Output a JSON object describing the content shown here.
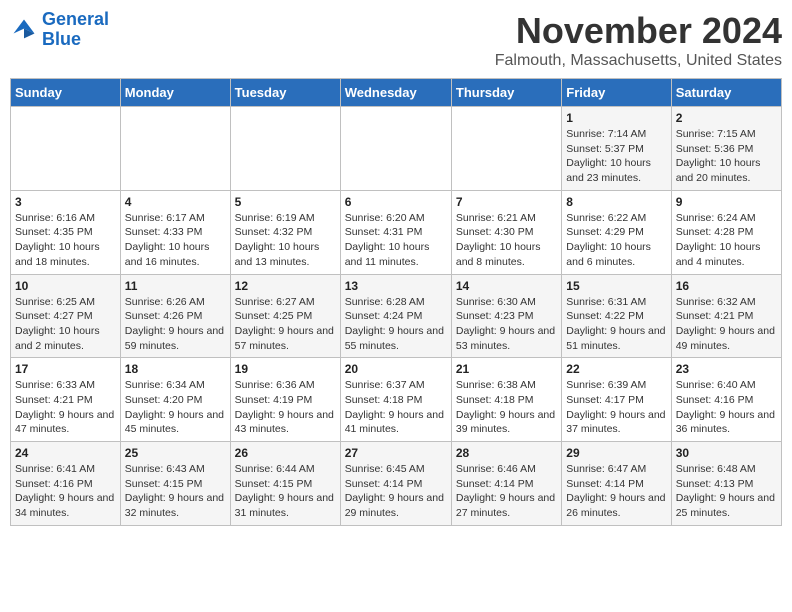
{
  "header": {
    "logo_line1": "General",
    "logo_line2": "Blue",
    "month": "November 2024",
    "location": "Falmouth, Massachusetts, United States"
  },
  "weekdays": [
    "Sunday",
    "Monday",
    "Tuesday",
    "Wednesday",
    "Thursday",
    "Friday",
    "Saturday"
  ],
  "weeks": [
    [
      {
        "day": "",
        "info": ""
      },
      {
        "day": "",
        "info": ""
      },
      {
        "day": "",
        "info": ""
      },
      {
        "day": "",
        "info": ""
      },
      {
        "day": "",
        "info": ""
      },
      {
        "day": "1",
        "info": "Sunrise: 7:14 AM\nSunset: 5:37 PM\nDaylight: 10 hours and 23 minutes."
      },
      {
        "day": "2",
        "info": "Sunrise: 7:15 AM\nSunset: 5:36 PM\nDaylight: 10 hours and 20 minutes."
      }
    ],
    [
      {
        "day": "3",
        "info": "Sunrise: 6:16 AM\nSunset: 4:35 PM\nDaylight: 10 hours and 18 minutes."
      },
      {
        "day": "4",
        "info": "Sunrise: 6:17 AM\nSunset: 4:33 PM\nDaylight: 10 hours and 16 minutes."
      },
      {
        "day": "5",
        "info": "Sunrise: 6:19 AM\nSunset: 4:32 PM\nDaylight: 10 hours and 13 minutes."
      },
      {
        "day": "6",
        "info": "Sunrise: 6:20 AM\nSunset: 4:31 PM\nDaylight: 10 hours and 11 minutes."
      },
      {
        "day": "7",
        "info": "Sunrise: 6:21 AM\nSunset: 4:30 PM\nDaylight: 10 hours and 8 minutes."
      },
      {
        "day": "8",
        "info": "Sunrise: 6:22 AM\nSunset: 4:29 PM\nDaylight: 10 hours and 6 minutes."
      },
      {
        "day": "9",
        "info": "Sunrise: 6:24 AM\nSunset: 4:28 PM\nDaylight: 10 hours and 4 minutes."
      }
    ],
    [
      {
        "day": "10",
        "info": "Sunrise: 6:25 AM\nSunset: 4:27 PM\nDaylight: 10 hours and 2 minutes."
      },
      {
        "day": "11",
        "info": "Sunrise: 6:26 AM\nSunset: 4:26 PM\nDaylight: 9 hours and 59 minutes."
      },
      {
        "day": "12",
        "info": "Sunrise: 6:27 AM\nSunset: 4:25 PM\nDaylight: 9 hours and 57 minutes."
      },
      {
        "day": "13",
        "info": "Sunrise: 6:28 AM\nSunset: 4:24 PM\nDaylight: 9 hours and 55 minutes."
      },
      {
        "day": "14",
        "info": "Sunrise: 6:30 AM\nSunset: 4:23 PM\nDaylight: 9 hours and 53 minutes."
      },
      {
        "day": "15",
        "info": "Sunrise: 6:31 AM\nSunset: 4:22 PM\nDaylight: 9 hours and 51 minutes."
      },
      {
        "day": "16",
        "info": "Sunrise: 6:32 AM\nSunset: 4:21 PM\nDaylight: 9 hours and 49 minutes."
      }
    ],
    [
      {
        "day": "17",
        "info": "Sunrise: 6:33 AM\nSunset: 4:21 PM\nDaylight: 9 hours and 47 minutes."
      },
      {
        "day": "18",
        "info": "Sunrise: 6:34 AM\nSunset: 4:20 PM\nDaylight: 9 hours and 45 minutes."
      },
      {
        "day": "19",
        "info": "Sunrise: 6:36 AM\nSunset: 4:19 PM\nDaylight: 9 hours and 43 minutes."
      },
      {
        "day": "20",
        "info": "Sunrise: 6:37 AM\nSunset: 4:18 PM\nDaylight: 9 hours and 41 minutes."
      },
      {
        "day": "21",
        "info": "Sunrise: 6:38 AM\nSunset: 4:18 PM\nDaylight: 9 hours and 39 minutes."
      },
      {
        "day": "22",
        "info": "Sunrise: 6:39 AM\nSunset: 4:17 PM\nDaylight: 9 hours and 37 minutes."
      },
      {
        "day": "23",
        "info": "Sunrise: 6:40 AM\nSunset: 4:16 PM\nDaylight: 9 hours and 36 minutes."
      }
    ],
    [
      {
        "day": "24",
        "info": "Sunrise: 6:41 AM\nSunset: 4:16 PM\nDaylight: 9 hours and 34 minutes."
      },
      {
        "day": "25",
        "info": "Sunrise: 6:43 AM\nSunset: 4:15 PM\nDaylight: 9 hours and 32 minutes."
      },
      {
        "day": "26",
        "info": "Sunrise: 6:44 AM\nSunset: 4:15 PM\nDaylight: 9 hours and 31 minutes."
      },
      {
        "day": "27",
        "info": "Sunrise: 6:45 AM\nSunset: 4:14 PM\nDaylight: 9 hours and 29 minutes."
      },
      {
        "day": "28",
        "info": "Sunrise: 6:46 AM\nSunset: 4:14 PM\nDaylight: 9 hours and 27 minutes."
      },
      {
        "day": "29",
        "info": "Sunrise: 6:47 AM\nSunset: 4:14 PM\nDaylight: 9 hours and 26 minutes."
      },
      {
        "day": "30",
        "info": "Sunrise: 6:48 AM\nSunset: 4:13 PM\nDaylight: 9 hours and 25 minutes."
      }
    ]
  ]
}
